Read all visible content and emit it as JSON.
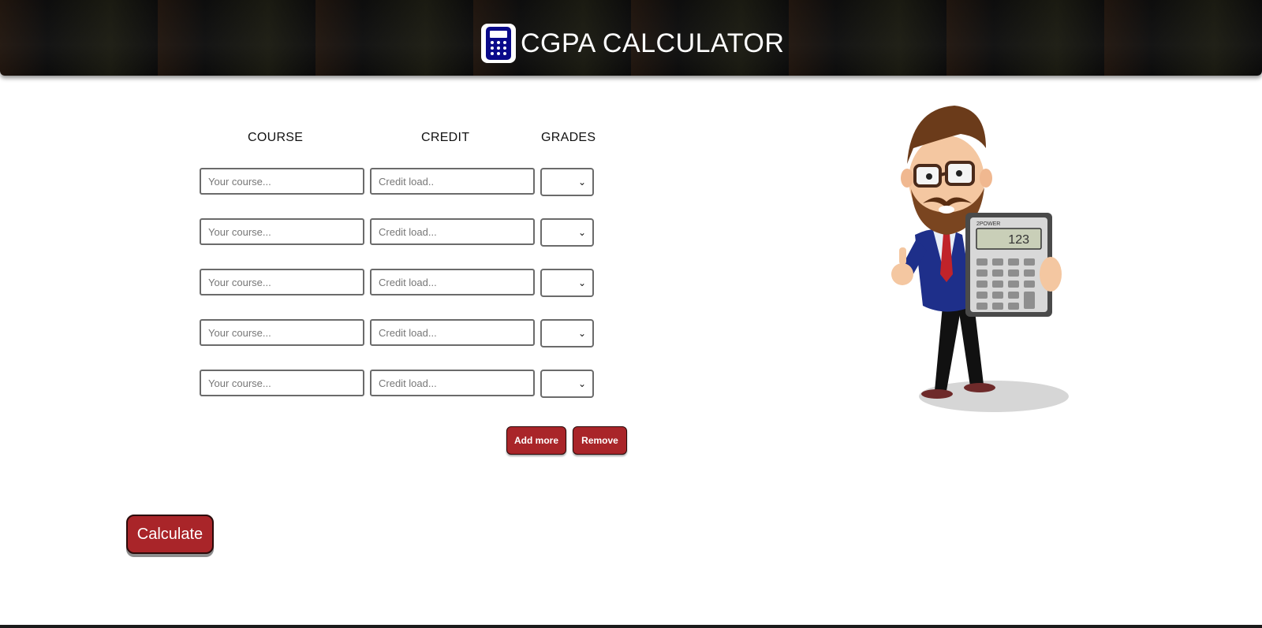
{
  "header": {
    "title": "CGPA CALCULATOR",
    "logo_icon": "calculator-icon"
  },
  "table": {
    "headers": {
      "course": "COURSE",
      "credit": "CREDIT",
      "grades": "GRADES"
    },
    "rows": [
      {
        "course_placeholder": "Your course...",
        "credit_placeholder": "Credit load..",
        "grade_value": ""
      },
      {
        "course_placeholder": "Your course...",
        "credit_placeholder": "Credit load...",
        "grade_value": ""
      },
      {
        "course_placeholder": "Your course...",
        "credit_placeholder": "Credit load...",
        "grade_value": ""
      },
      {
        "course_placeholder": "Your course...",
        "credit_placeholder": "Credit load...",
        "grade_value": ""
      },
      {
        "course_placeholder": "Your course...",
        "credit_placeholder": "Credit load...",
        "grade_value": ""
      }
    ]
  },
  "buttons": {
    "add_more": "Add more",
    "remove": "Remove",
    "calculate": "Calculate"
  },
  "illustration": {
    "calculator_display": "123",
    "calculator_brand": "2POWER",
    "icon": "man-with-calculator-illustration"
  },
  "colors": {
    "accent": "#a92529",
    "header_bg": "#111111",
    "logo_blue": "#0a0a8a"
  }
}
